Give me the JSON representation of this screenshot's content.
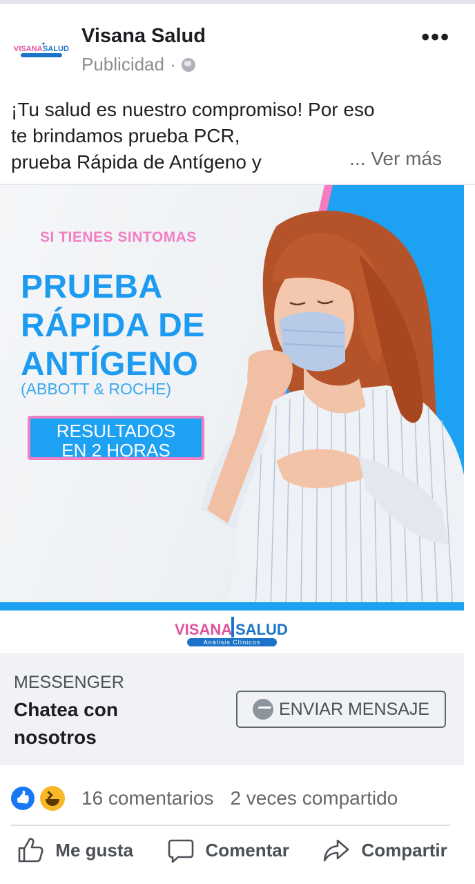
{
  "post": {
    "page_name": "Visana Salud",
    "sponsored_label": "Publicidad",
    "separator": "·",
    "more_icon": "more-dots-icon",
    "text_lines": [
      "¡Tu salud es nuestro compromiso! Por eso",
      "te brindamos prueba PCR,",
      "prueba Rápida de Antígeno y"
    ],
    "see_more": "... Ver más"
  },
  "ad": {
    "tagline": "SI TIENES SINTOMAS",
    "headline": [
      "PRUEBA",
      "RÁPIDA DE",
      "ANTÍGENO"
    ],
    "brands": "(ABBOTT & ROCHE)",
    "results_badge": [
      "RESULTADOS",
      "EN 2 HORAS"
    ],
    "logo_left": "VISANA",
    "logo_right": "SALUD",
    "logo_sub": "Análisis Clínicos",
    "colors": {
      "blue": "#1da1f2",
      "pink": "#f27ec3"
    }
  },
  "messenger": {
    "label": "MESSENGER",
    "title": "Chatea con nosotros",
    "button_label": "ENVIAR MENSAJE",
    "button_icon": "messenger-icon"
  },
  "engagement": {
    "reactions": [
      "like-icon",
      "haha-icon"
    ],
    "comments": "16 comentarios",
    "shares": "2 veces compartido"
  },
  "actions": {
    "like": "Me gusta",
    "comment": "Comentar",
    "share": "Compartir"
  }
}
